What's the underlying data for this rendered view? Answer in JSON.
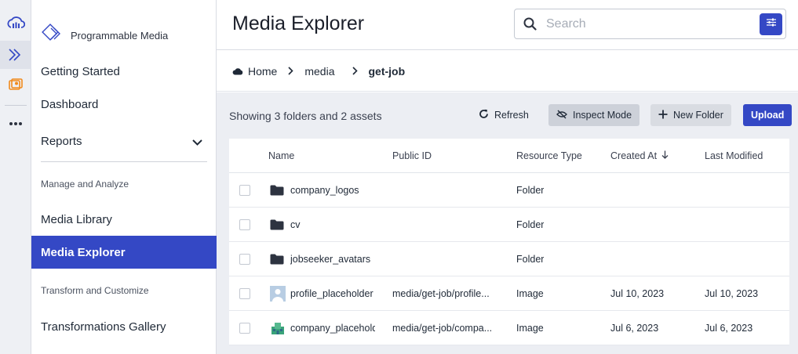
{
  "sidebar": {
    "brand_label": "Programmable Media",
    "items": [
      {
        "label": "Getting Started"
      },
      {
        "label": "Dashboard"
      },
      {
        "label": "Reports"
      },
      {
        "label": "Media Library"
      },
      {
        "label": "Media Explorer"
      },
      {
        "label": "Transformations Gallery"
      }
    ],
    "sections": [
      "Manage and Analyze",
      "Transform and Customize"
    ]
  },
  "header": {
    "title": "Media Explorer",
    "search_placeholder": "Search"
  },
  "breadcrumb": [
    "Home",
    "media",
    "get-job"
  ],
  "toolbar": {
    "showing": "Showing 3 folders and 2 assets",
    "refresh": "Refresh",
    "inspect": "Inspect Mode",
    "new_folder": "New Folder",
    "upload": "Upload"
  },
  "table": {
    "columns": [
      "Name",
      "Public ID",
      "Resource Type",
      "Created At",
      "Last Modified"
    ],
    "rows": [
      {
        "name": "company_logos",
        "public_id": "",
        "type": "Folder",
        "created": "",
        "modified": "",
        "kind": "folder-icon"
      },
      {
        "name": "cv",
        "public_id": "",
        "type": "Folder",
        "created": "",
        "modified": "",
        "kind": "folder-icon"
      },
      {
        "name": "jobseeker_avatars",
        "public_id": "",
        "type": "Folder",
        "created": "",
        "modified": "",
        "kind": "folder-icon"
      },
      {
        "name": "profile_placeholder",
        "public_id": "media/get-job/profile...",
        "type": "Image",
        "created": "Jul 10, 2023",
        "modified": "Jul 10, 2023",
        "kind": "person-thumbnail-icon"
      },
      {
        "name": "company_placeholder",
        "public_id": "media/get-job/compa...",
        "type": "Image",
        "created": "Jul 6, 2023",
        "modified": "Jul 6, 2023",
        "kind": "building-thumbnail-icon"
      }
    ]
  },
  "colors": {
    "accent": "#3448c5",
    "content_bg": "#eceef3"
  }
}
